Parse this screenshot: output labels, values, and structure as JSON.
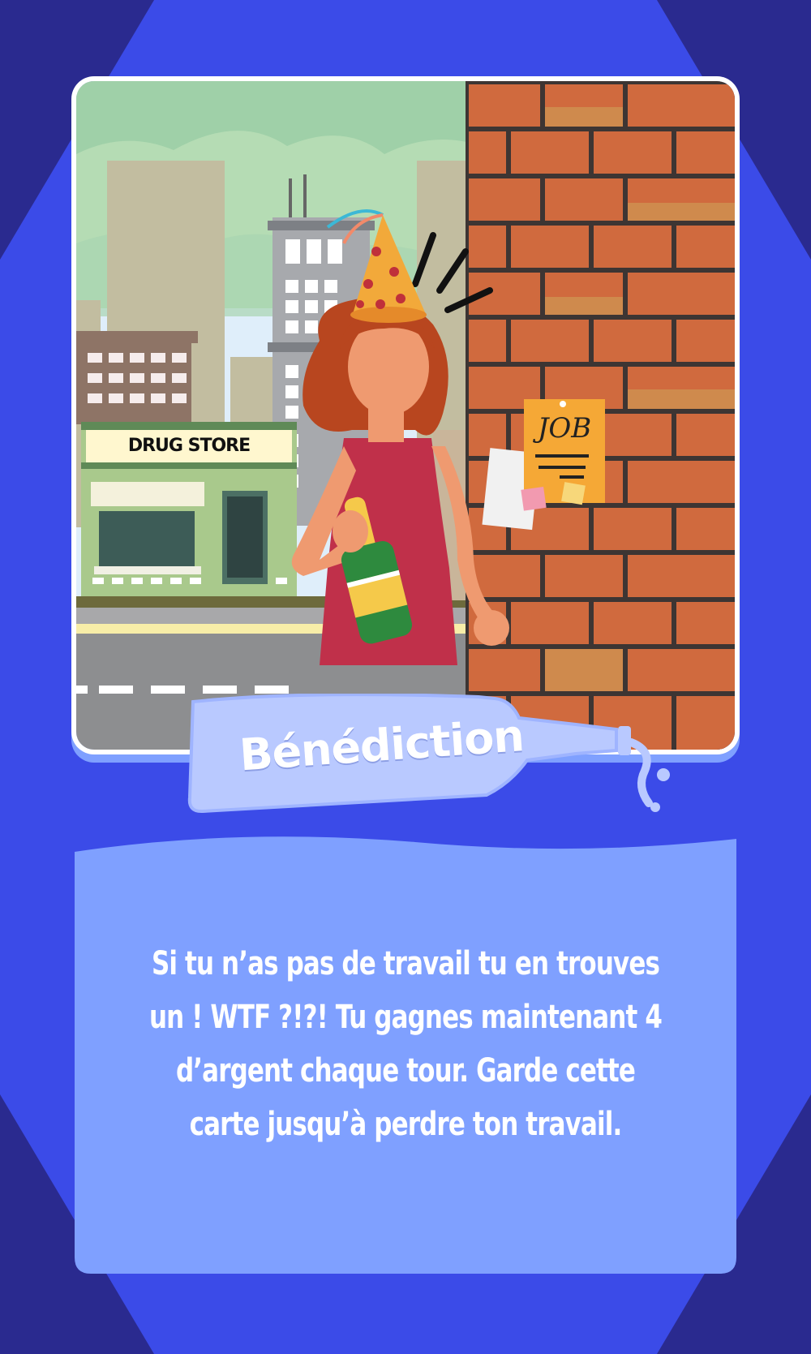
{
  "card": {
    "title": "Bénédiction",
    "description": "Si tu n’as pas de travail tu en trouves un ! WTF ?!?! Tu gagnes maintenant 4 d’argent chaque tour. Garde cette carte jusqu’à perdre ton travail."
  },
  "illustration": {
    "store_sign": "DRUG STORE",
    "notice_label": "JOB"
  },
  "colors": {
    "outer_background": "#2a2a8f",
    "hexagon": "#3b4be8",
    "panel": "#7fa0ff",
    "brick": "#d06a3e",
    "dress": "#c0304a"
  }
}
